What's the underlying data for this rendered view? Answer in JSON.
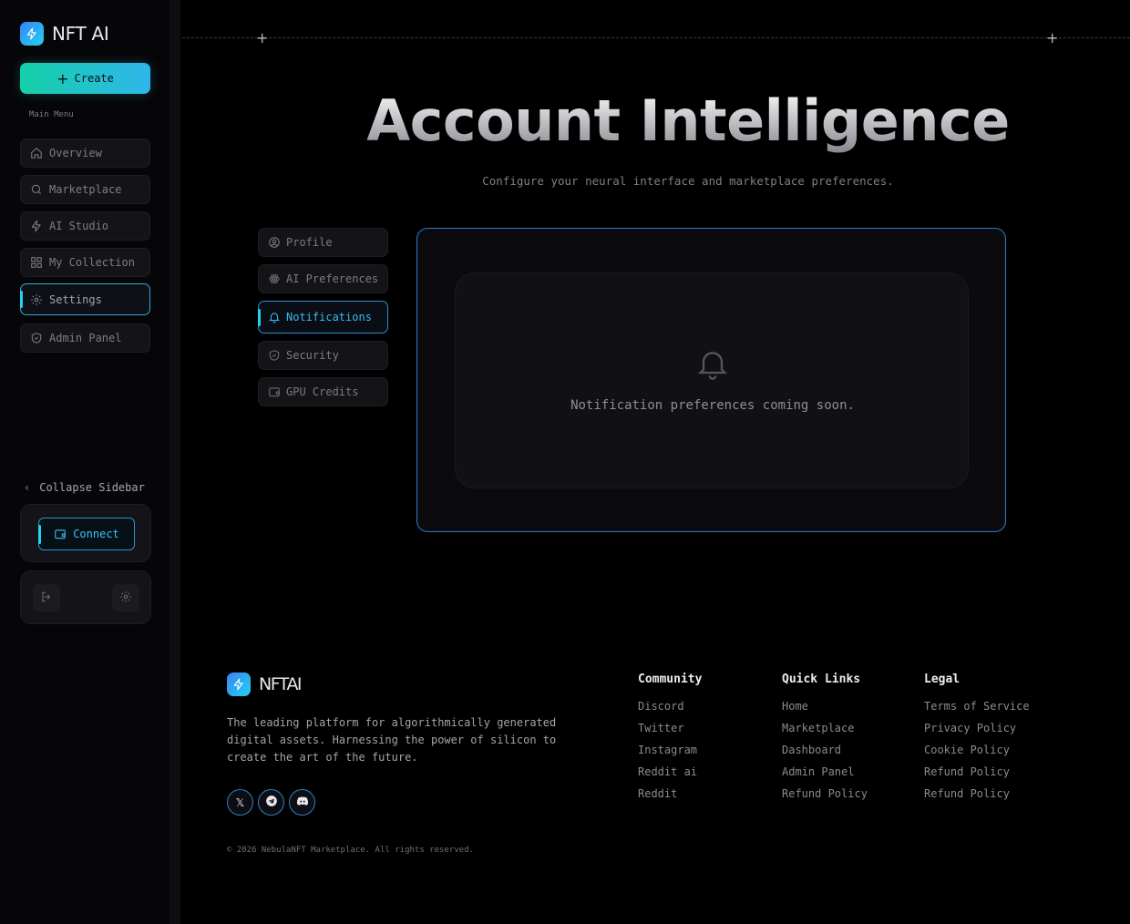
{
  "app": {
    "name": "NFT AI",
    "logo_icon": "bolt-icon"
  },
  "sidebar": {
    "create_label": "Create",
    "menu_label": "Main Menu",
    "items": [
      {
        "label": "Overview",
        "icon": "home-icon"
      },
      {
        "label": "Marketplace",
        "icon": "search-icon"
      },
      {
        "label": "AI Studio",
        "icon": "bolt-icon"
      },
      {
        "label": "My Collection",
        "icon": "grid-icon"
      },
      {
        "label": "Settings",
        "icon": "gear-icon",
        "active": true
      },
      {
        "label": "Admin Panel",
        "icon": "shield-icon"
      }
    ],
    "collapse_label": "Collapse Sidebar",
    "connect_label": "Connect"
  },
  "main": {
    "title": "Account Intelligence",
    "subtitle": "Configure your neural interface and marketplace preferences.",
    "tabs": [
      {
        "label": "Profile",
        "icon": "user-circle-icon"
      },
      {
        "label": "AI Preferences",
        "icon": "atom-icon"
      },
      {
        "label": "Notifications",
        "icon": "bell-icon",
        "active": true
      },
      {
        "label": "Security",
        "icon": "shield-icon"
      },
      {
        "label": "GPU Credits",
        "icon": "wallet-icon"
      }
    ],
    "panel_message": "Notification preferences coming soon."
  },
  "footer": {
    "brand": "NFTAI",
    "description": "The leading platform for algorithmically generated digital assets. Harnessing the power of silicon to create the art of the future.",
    "socials": [
      "x-icon",
      "telegram-icon",
      "discord-icon"
    ],
    "copyright": "© 2026 NebulaNFT Marketplace. All rights reserved.",
    "columns": [
      {
        "title": "Community",
        "links": [
          "Discord",
          "Twitter",
          "Instagram",
          "Reddit ai",
          "Reddit"
        ]
      },
      {
        "title": "Quick Links",
        "links": [
          "Home",
          "Marketplace",
          "Dashboard",
          "Admin Panel",
          "Refund Policy"
        ]
      },
      {
        "title": "Legal",
        "links": [
          "Terms of Service",
          "Privacy Policy",
          "Cookie Policy",
          "Refund Policy",
          "Refund Policy"
        ]
      }
    ]
  },
  "colors": {
    "accent_cyan": "#22d3ee",
    "accent_blue": "#3b82f6",
    "background": "#000000"
  }
}
